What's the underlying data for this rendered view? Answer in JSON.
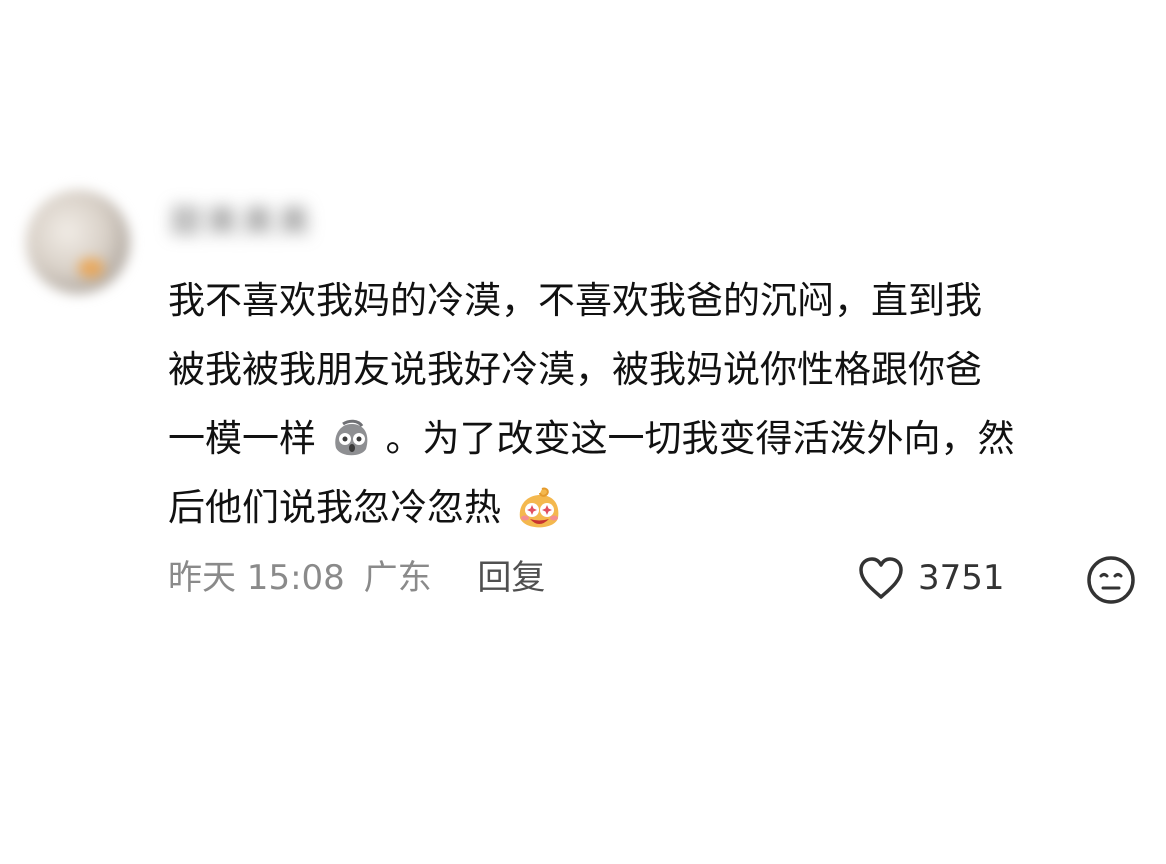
{
  "comment": {
    "username": "甜美美美",
    "text_line_1": "我不喜欢我妈的冷漠，不喜欢我爸的沉闷，直到我",
    "text_line_2": "被我被我朋友说我好冷漠，被我妈说你性格跟你爸",
    "text_line_3a": "一模一样",
    "text_line_3b": "。为了改变这一切我变得活泼外向，然",
    "text_line_4": "后他们说我忽冷忽热",
    "emoji_1": "grey-blob-emoji",
    "emoji_2": "happy-orange-blob-emoji",
    "time": "昨天 15:08",
    "location": "广东",
    "reply_label": "回复",
    "like_count": "3751",
    "icons": {
      "like": "heart-icon",
      "reaction": "neutral-face-icon"
    },
    "colors": {
      "text": "#111111",
      "meta": "#8a8a8a",
      "reply": "#505050",
      "icon": "#333333"
    }
  }
}
